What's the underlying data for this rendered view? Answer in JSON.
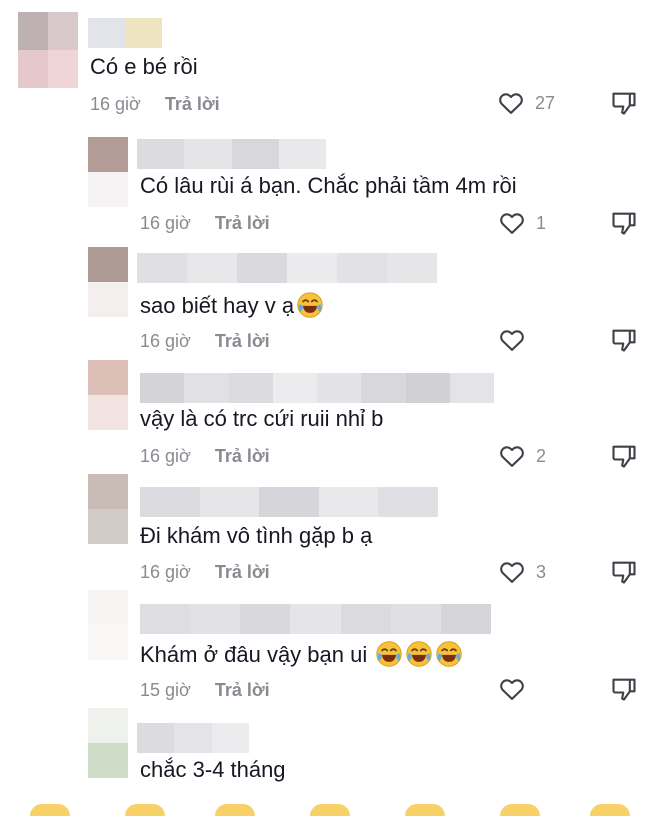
{
  "icons": {
    "like": "heart-outline-icon",
    "dislike": "thumbs-down-icon",
    "emoji": "joy-emoji-icon"
  },
  "colors": {
    "text": "#161823",
    "meta": "#8a8b91",
    "icon": "#3f4048"
  },
  "comments": [
    {
      "text": "Có e bé rồi",
      "time": "16 giờ",
      "reply_label": "Trả lời",
      "likes": "27",
      "emoji_count": 0
    },
    {
      "text": "Có lâu rùi á bạn. Chắc phải tầm 4m rồi",
      "time": "16 giờ",
      "reply_label": "Trả lời",
      "likes": "1",
      "emoji_count": 0
    },
    {
      "text": "sao biết hay v ạ",
      "time": "16 giờ",
      "reply_label": "Trả lời",
      "likes": "",
      "emoji_count": 1
    },
    {
      "text": "vậy là có trc cứi ruii nhỉ b",
      "time": "16 giờ",
      "reply_label": "Trả lời",
      "likes": "2",
      "emoji_count": 0
    },
    {
      "text": "Đi khám vô tình gặp b ạ",
      "time": "16 giờ",
      "reply_label": "Trả lời",
      "likes": "3",
      "emoji_count": 0
    },
    {
      "text": "Khám ở đâu vậy bạn ui",
      "time": "15 giờ",
      "reply_label": "Trả lời",
      "likes": "",
      "emoji_count": 3
    },
    {
      "text": "chắc 3-4 tháng"
    }
  ]
}
